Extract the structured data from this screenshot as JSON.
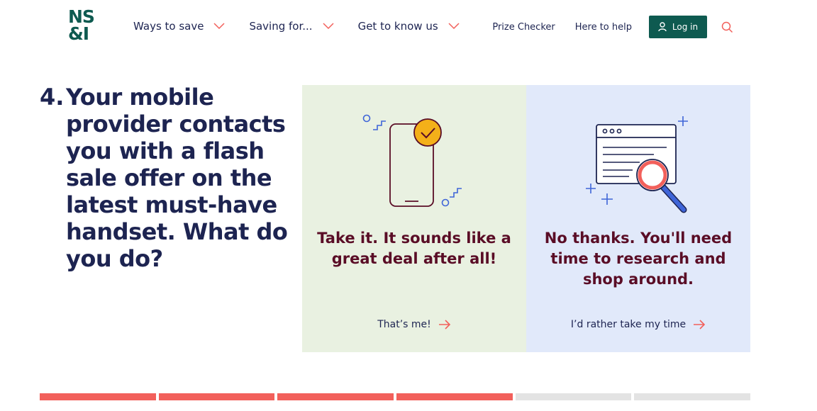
{
  "brand": {
    "logo_line1": "NS",
    "logo_line2": "&I",
    "brand_color": "#0e5a50"
  },
  "nav": {
    "items": [
      {
        "label": "Ways to save",
        "icon": "chevron-down-icon"
      },
      {
        "label": "Saving for...",
        "icon": "chevron-down-icon"
      },
      {
        "label": "Get to know us",
        "icon": "chevron-down-icon"
      }
    ]
  },
  "utility": {
    "prize_checker": "Prize Checker",
    "help": "Here to help",
    "login_label": "Log in",
    "login_icon": "user-icon",
    "search_icon": "search-icon"
  },
  "question": {
    "number": "4.",
    "text": "Your mobile provider contacts you with a flash sale offer on the latest must-have handset. What do you do?"
  },
  "options": [
    {
      "title": "Take it. It sounds like a great deal after all!",
      "action": "That’s me!",
      "illustration": "phone-check-icon",
      "background": "#e9f1e1"
    },
    {
      "title": "No thanks. You'll need time to research and shop around.",
      "action": "I’d rather take my time",
      "illustration": "browser-magnifier-icon",
      "background": "#e1e9fa"
    }
  ],
  "progress": {
    "current_step": 4,
    "total_steps": 6,
    "done_color": "#f2605b",
    "todo_color": "#e3e3e3"
  }
}
